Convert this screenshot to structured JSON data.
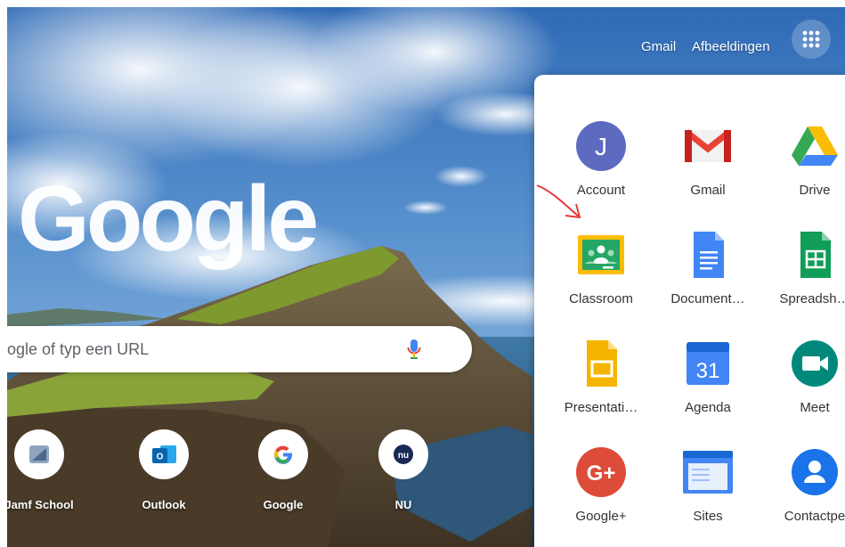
{
  "header": {
    "gmail_label": "Gmail",
    "images_label": "Afbeeldingen"
  },
  "logo_text": "Google",
  "search": {
    "placeholder": "ogle of typ een URL"
  },
  "shortcuts": [
    {
      "label": "Jamf School",
      "icon": "jamf-school-icon"
    },
    {
      "label": "Outlook",
      "icon": "outlook-icon"
    },
    {
      "label": "Google",
      "icon": "google-g-icon"
    },
    {
      "label": "NU",
      "icon": "nu-icon"
    }
  ],
  "apps_panel": {
    "items": [
      {
        "label": "Account",
        "icon": "account-icon",
        "avatar_letter": "J"
      },
      {
        "label": "Gmail",
        "icon": "gmail-icon"
      },
      {
        "label": "Drive",
        "icon": "drive-icon"
      },
      {
        "label": "Classroom",
        "icon": "classroom-icon"
      },
      {
        "label": "Document…",
        "icon": "docs-icon"
      },
      {
        "label": "Spreadsh…",
        "icon": "sheets-icon"
      },
      {
        "label": "Presentati…",
        "icon": "slides-icon"
      },
      {
        "label": "Agenda",
        "icon": "calendar-icon",
        "day": "31"
      },
      {
        "label": "Meet",
        "icon": "meet-icon"
      },
      {
        "label": "Google+",
        "icon": "google-plus-icon",
        "glyph": "G+"
      },
      {
        "label": "Sites",
        "icon": "sites-icon"
      },
      {
        "label": "Contactpe",
        "icon": "contacts-icon"
      }
    ]
  },
  "colors": {
    "google_blue": "#4285f4",
    "google_red": "#ea4335",
    "google_yellow": "#fbbc04",
    "google_green": "#34a853",
    "annotation": "#e53935"
  }
}
